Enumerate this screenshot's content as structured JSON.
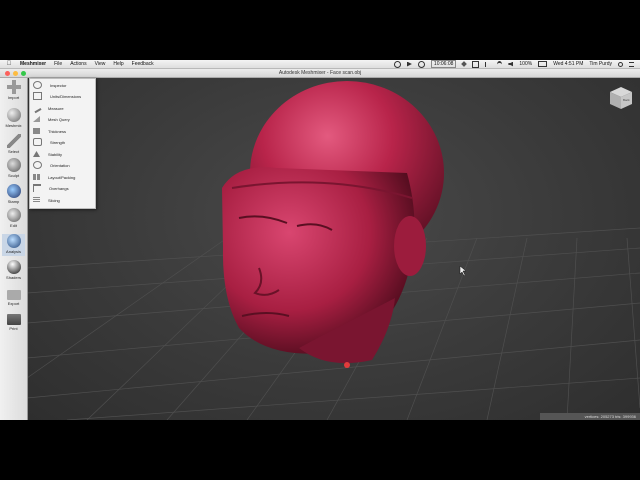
{
  "menubar": {
    "app_name": "Meshmixer",
    "menus": [
      "File",
      "Actions",
      "View",
      "Help",
      "Feedback"
    ],
    "clock_box": "10:06:08",
    "battery": "100%",
    "datetime": "Wed 4:51 PM",
    "user": "Tim Purdy"
  },
  "window": {
    "title": "Autodesk Meshmixer - Face scan.obj"
  },
  "toolbar": {
    "items": [
      {
        "label": "Import"
      },
      {
        "label": "Meshmix"
      },
      {
        "label": "Select"
      },
      {
        "label": "Sculpt"
      },
      {
        "label": "Stamp"
      },
      {
        "label": "Edit"
      },
      {
        "label": "Analysis"
      },
      {
        "label": "Shaders"
      },
      {
        "label": "Export"
      },
      {
        "label": "Print"
      }
    ]
  },
  "analysis_menu": {
    "items": [
      {
        "label": "Inspector"
      },
      {
        "label": "Units/Dimensions"
      },
      {
        "label": "Measure"
      },
      {
        "label": "Mesh Query"
      },
      {
        "label": "Thickness"
      },
      {
        "label": "Strength"
      },
      {
        "label": "Stability"
      },
      {
        "label": "Orientation"
      },
      {
        "label": "Layout/Packing"
      },
      {
        "label": "Overhangs"
      },
      {
        "label": "Slicing"
      }
    ]
  },
  "viewcube": {
    "label": "Back"
  },
  "statusbar": {
    "text": "vertices: 205273 tris: 399936"
  },
  "colors": {
    "model": "#b8244a",
    "grid": "#555555",
    "viewport_bg": "#3c3c3c"
  }
}
